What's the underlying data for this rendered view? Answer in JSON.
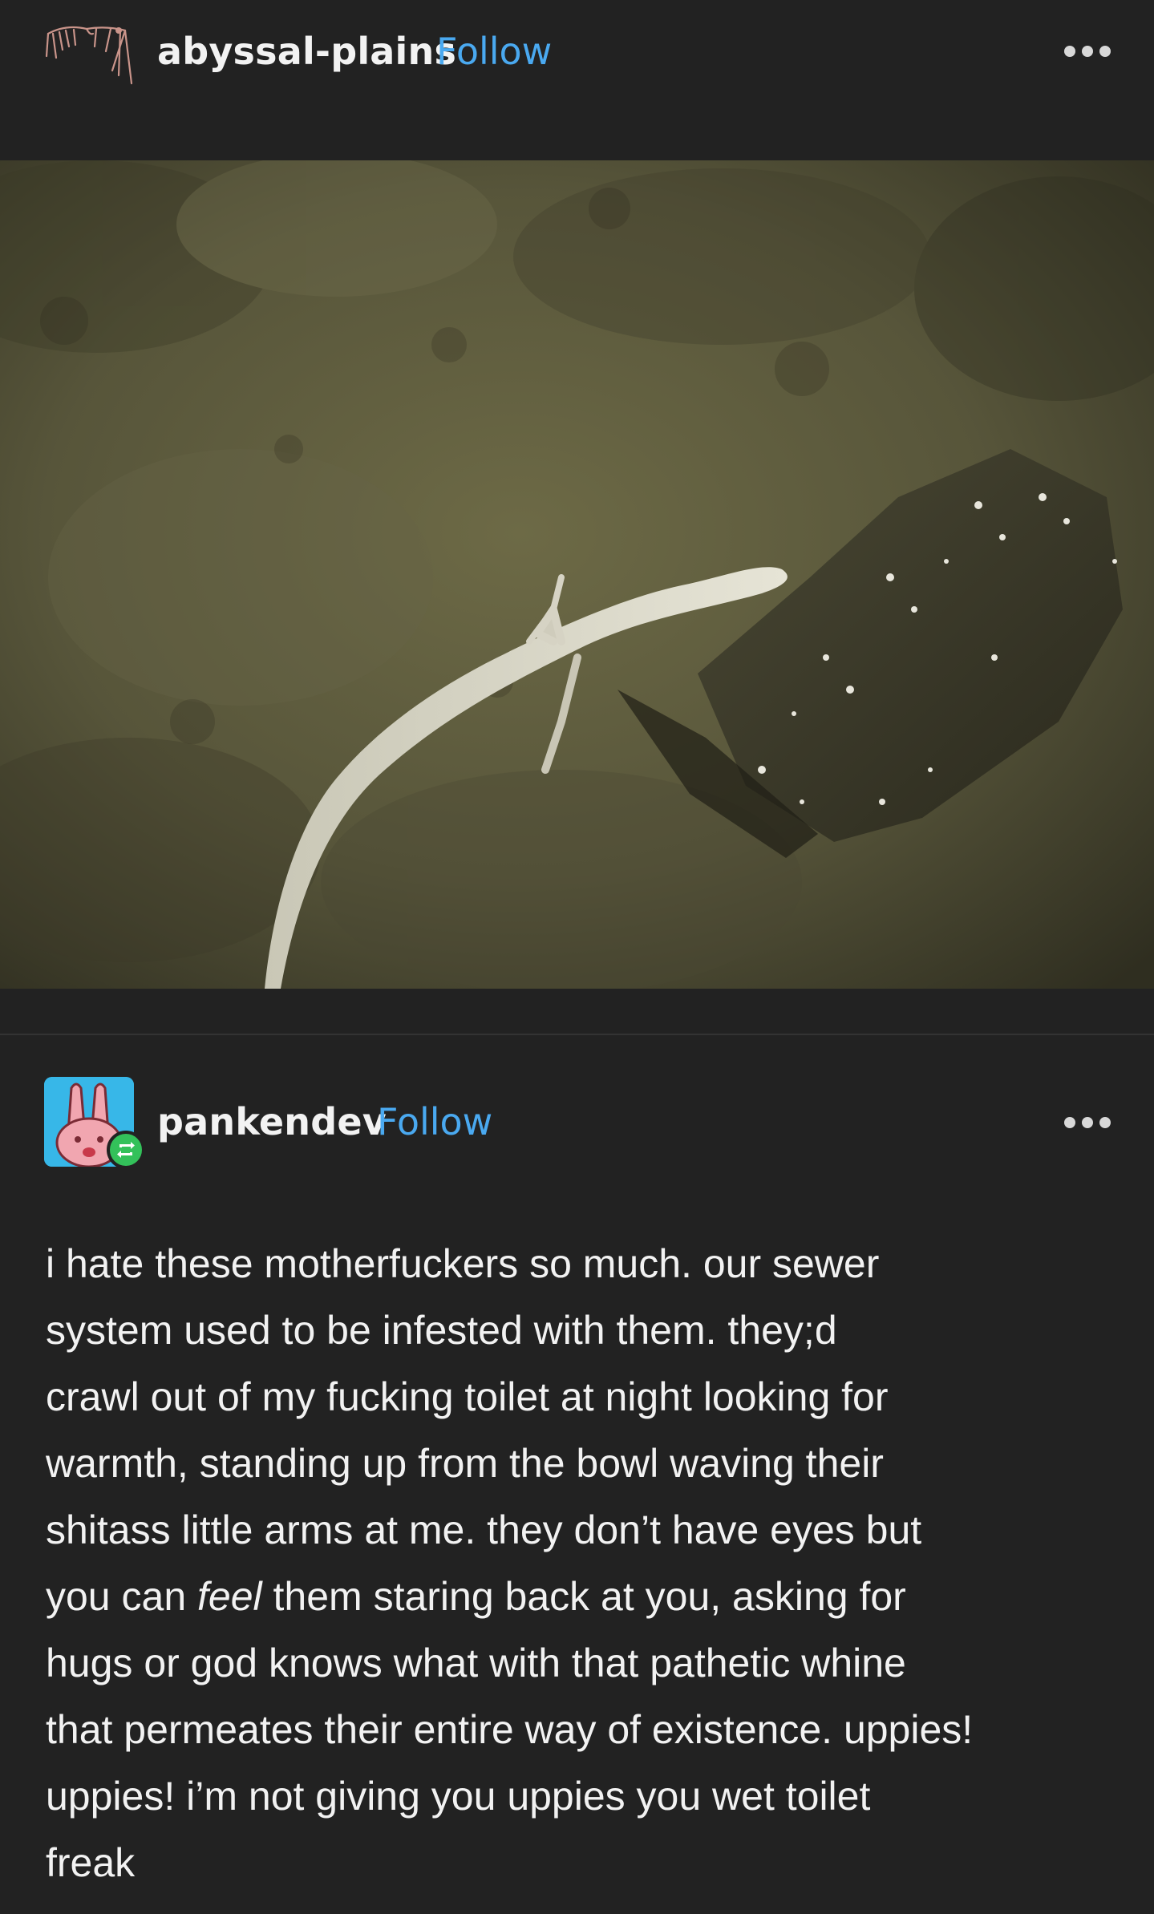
{
  "posts": [
    {
      "username": "abyssal-plains",
      "follow_label": "Follow",
      "avatar_icon": "spider-icon",
      "more_icon": "more-dots-icon",
      "media": "gif of a pale blind salamander crawling past a rock in a dark cave"
    },
    {
      "username": "pankendev",
      "follow_label": "Follow",
      "avatar_icon": "bunny-avatar-icon",
      "badge_icon": "reblog-icon",
      "more_icon": "more-dots-icon",
      "body_before": "i hate these motherfuckers so much. our sewer\nsystem used to be infested with them. they;d\ncrawl out of my fucking toilet at night looking for\nwarmth, standing up from the bowl waving their\nshitass little arms at me. they don’t have eyes but\nyou can ",
      "body_em": "feel",
      "body_after": " them staring back at you, asking for\nhugs or god knows what with that pathetic whine\nthat permeates their entire way of existence. uppies!\nuppies! i’m not giving you uppies you wet toilet\nfreak"
    }
  ],
  "colors": {
    "background": "#222222",
    "text": "#f2f2f2",
    "follow": "#4aa9f0",
    "reblog_badge": "#33c15a",
    "avatar_bg": "#37b7e8"
  }
}
